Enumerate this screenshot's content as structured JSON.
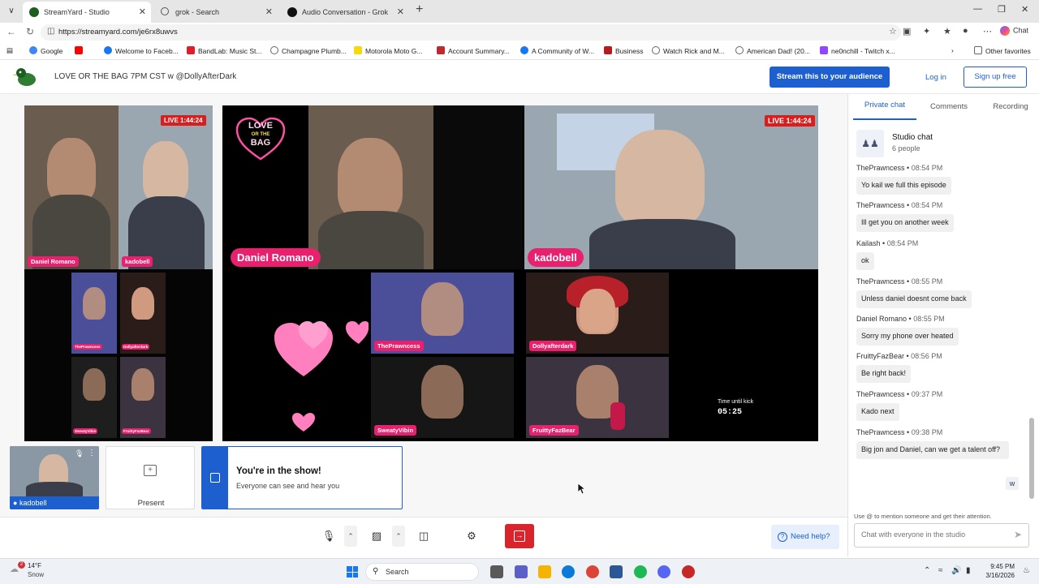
{
  "browser": {
    "tabs": [
      {
        "title": "StreamYard - Studio",
        "active": true
      },
      {
        "title": "grok - Search",
        "active": false
      },
      {
        "title": "Audio Conversation - Grok",
        "active": false
      }
    ],
    "url": "https://streamyard.com/je6rx8uwvs",
    "chat_label": "Chat",
    "favorites": [
      "Google",
      "Welcome to Faceb...",
      "BandLab: Music St...",
      "Champagne Plumb...",
      "Motorola Moto G...",
      "Account Summary...",
      "A Community of W...",
      "Business",
      "Watch Rick and M...",
      "American Dad! (20...",
      "ne0nchill - Twitch x..."
    ],
    "other_favorites": "Other favorites"
  },
  "header": {
    "title": "LOVE OR THE BAG 7PM CST w @DollyAfterDark",
    "stream_button": "Stream this to your audience",
    "login": "Log in",
    "signup": "Sign up free"
  },
  "stage": {
    "live_left": "LIVE 1:44:24",
    "live_right": "LIVE 1:44:24",
    "show_logo_line1": "LOVE",
    "show_logo_line2": "OR THE",
    "show_logo_line3": "BAG",
    "small_names": {
      "daniel": "Daniel Romano",
      "kado": "kadobell",
      "prawn": "ThePrawncess",
      "dolly": "Dollyafterdark",
      "sweaty": "SweatyVibin",
      "fruitty": "FruittyFazBear"
    },
    "big_names": {
      "daniel": "Daniel Romano",
      "kado": "kadobell",
      "prawn": "ThePrawncess",
      "dolly": "Dollyafterdark",
      "sweaty": "SweatyVibin",
      "fruitty": "FruittyFazBear"
    },
    "timer_label": "Time until kick",
    "timer_value": "05:25"
  },
  "tray": {
    "self_name": "kadobell",
    "present_label": "Present",
    "inshow_title": "You're in the show!",
    "inshow_sub": "Everyone can see and hear you",
    "need_help": "Need help?"
  },
  "panel": {
    "tabs": [
      "Private chat",
      "Comments",
      "Recording"
    ],
    "studio_title": "Studio chat",
    "studio_people": "6 people",
    "messages": [
      {
        "author": "ThePrawncess",
        "time": "08:54 PM",
        "text": "Yo kail we full this episode"
      },
      {
        "author": "ThePrawncess",
        "time": "08:54 PM",
        "text": "Ill get you on another week"
      },
      {
        "author": "Kailash",
        "time": "08:54 PM",
        "text": "ok"
      },
      {
        "author": "ThePrawncess",
        "time": "08:55 PM",
        "text": "Unless daniel doesnt come back"
      },
      {
        "author": "Daniel Romano",
        "time": "08:55 PM",
        "text": "Sorry my phone over heated"
      },
      {
        "author": "FruittyFazBear",
        "time": "08:56 PM",
        "text": "Be right back!"
      },
      {
        "author": "ThePrawncess",
        "time": "09:37 PM",
        "text": "Kado next"
      },
      {
        "author": "ThePrawncess",
        "time": "09:38 PM",
        "text": "Big jon and Daniel, can we get a talent off?"
      }
    ],
    "own_message": "w",
    "hint": "Use @ to mention someone and get their attention.",
    "input_placeholder": "Chat with everyone in the studio"
  },
  "taskbar": {
    "temp": "14°F",
    "condition": "Snow",
    "weather_badge": "2",
    "search": "Search",
    "time": "9:45 PM",
    "date": "3/16/2026"
  }
}
